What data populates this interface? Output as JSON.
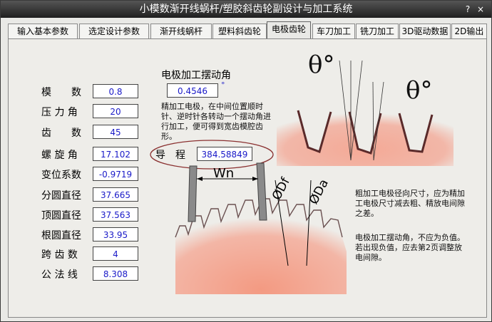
{
  "window": {
    "title": "小模数渐开线蜗杆/塑胶斜齿轮副设计与加工系统"
  },
  "titlebar_buttons": {
    "help": "?",
    "close": "×"
  },
  "tabs": [
    {
      "label": "输入基本参数"
    },
    {
      "label": "选定设计参数"
    },
    {
      "label": "渐开线蜗杆"
    },
    {
      "label": "塑料斜齿轮"
    },
    {
      "label": "电极齿轮"
    },
    {
      "label": "车刀加工"
    },
    {
      "label": "铣刀加工"
    },
    {
      "label": "3D驱动数据"
    },
    {
      "label": "2D输出"
    }
  ],
  "params": [
    {
      "label": "模　　数",
      "value": "0.8"
    },
    {
      "label": "压 力 角",
      "value": "20"
    },
    {
      "label": "齿　　数",
      "value": "45"
    },
    {
      "label": "螺 旋 角",
      "value": "17.102"
    },
    {
      "label": "变位系数",
      "value": "-0.9719"
    },
    {
      "label": "分圆直径",
      "value": "37.665"
    },
    {
      "label": "顶圆直径",
      "value": "37.563"
    },
    {
      "label": "根圆直径",
      "value": "33.95"
    },
    {
      "label": "跨 齿 数",
      "value": "4"
    },
    {
      "label": "公 法 线",
      "value": "8.308"
    }
  ],
  "swing": {
    "title": "电极加工摆动角",
    "value": "0.4546",
    "unit": "°",
    "note": "精加工电极，在中间位置顺时针、逆时针各转动一个摆动角进行加工，便可得到宽齿模腔齿形。"
  },
  "lead": {
    "label": "导　程",
    "value": "384.58849"
  },
  "figure": {
    "theta1": "θ°",
    "theta2": "θ°",
    "wn": "Wn",
    "df": "ØDf",
    "da": "ØDa"
  },
  "notes": {
    "rough": "粗加工电极径向尺寸，应为精加工电极尺寸减去粗、精放电间隙之差。",
    "warning": "电极加工摆动角，不应为负值。若出现负值，应去第2页调整放电间隙。"
  },
  "colors": {
    "gear": "#f0a890",
    "field_text": "#1a1ac8",
    "ellipse": "#8a3030"
  }
}
